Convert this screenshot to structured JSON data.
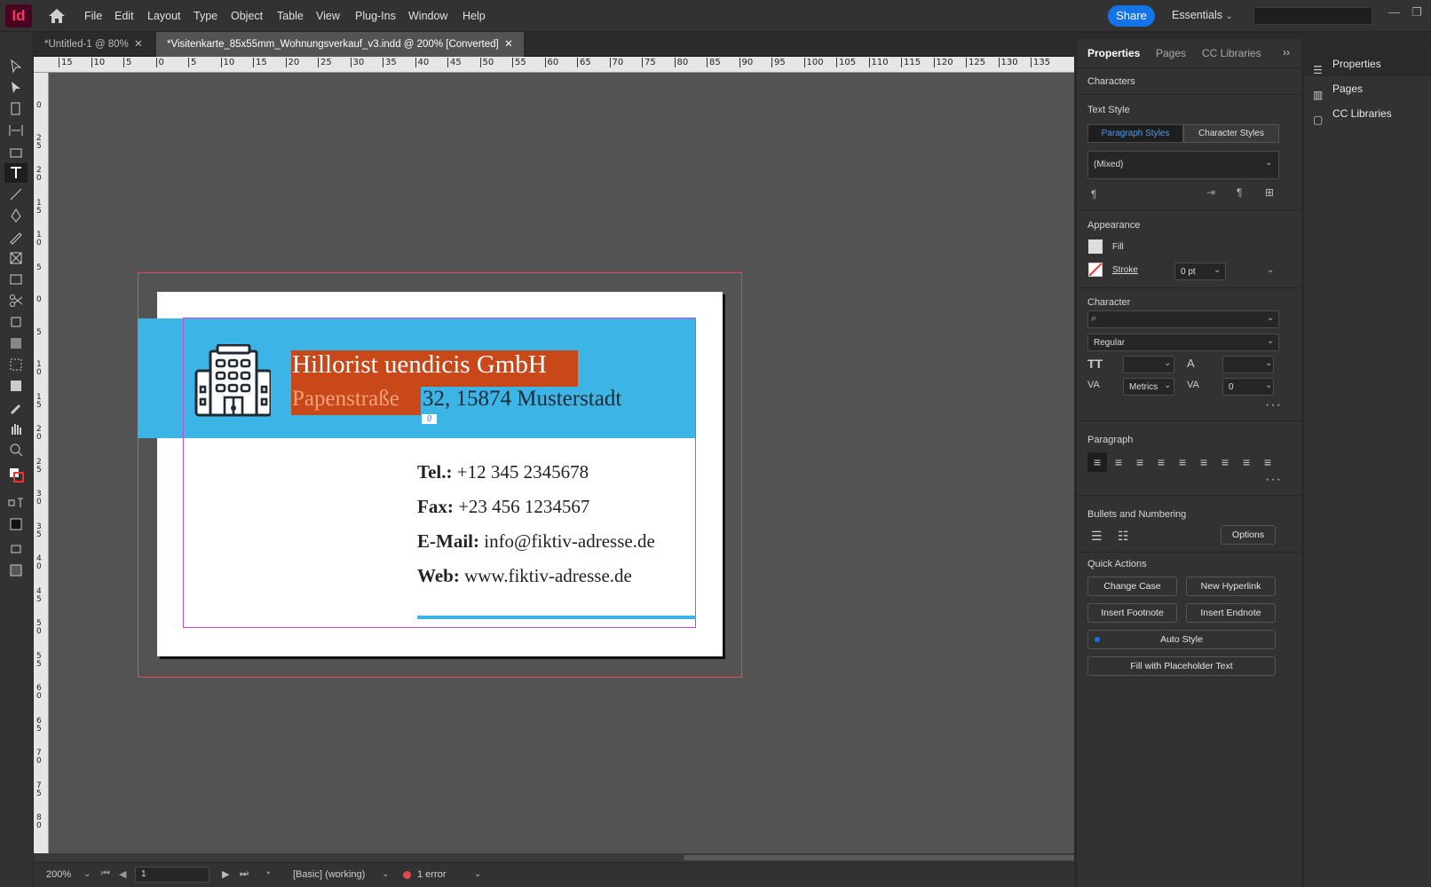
{
  "app": {
    "logo": "Id"
  },
  "menu": [
    "File",
    "Edit",
    "Layout",
    "Type",
    "Object",
    "Table",
    "View",
    "Plug-Ins",
    "Window",
    "Help"
  ],
  "header": {
    "share": "Share",
    "workspace": "Essentials"
  },
  "tabs": [
    {
      "label": "*Untitled-1 @ 80%"
    },
    {
      "label": "*Visitenkarte_85x55mm_Wohnungsverkauf_v3.indd @ 200% [Converted]"
    }
  ],
  "ruler": {
    "h_ticks": [
      "15",
      "10",
      "5",
      "0",
      "5",
      "10",
      "15",
      "20",
      "25",
      "30",
      "35",
      "40",
      "45",
      "50",
      "55",
      "60",
      "65",
      "70",
      "75",
      "80",
      "85",
      "90",
      "95",
      "100",
      "105",
      "110",
      "115",
      "120",
      "125",
      "130",
      "135"
    ],
    "v_ticks": [
      "0",
      "2\n5",
      "2\n0",
      "1\n5",
      "1\n0",
      "5",
      "0",
      "5",
      "1\n0",
      "1\n5",
      "2\n0",
      "2\n5",
      "3\n0",
      "3\n5",
      "4\n0",
      "4\n5",
      "5\n0",
      "5\n5",
      "6\n0",
      "6\n5",
      "7\n0",
      "7\n5",
      "8\n0"
    ]
  },
  "card": {
    "company": "Hillorist uendicis GmbH",
    "street": "Papenstraße ",
    "city": "32, 15874 Musterstadt",
    "overset": "0",
    "contacts": [
      {
        "label": "Tel.:",
        "value": " +12 345 2345678"
      },
      {
        "label": "Fax:",
        "value": " +23 456 1234567"
      },
      {
        "label": "E-Mail:",
        "value": " info@fiktiv-adresse.de"
      },
      {
        "label": "Web:",
        "value": " www.fiktiv-adresse.de"
      }
    ],
    "accent_color": "#3cb5e6",
    "selection_color": "#c9481a"
  },
  "status": {
    "zoom": "200%",
    "page": "1",
    "profile": "[Basic] (working)",
    "errors": "1 error"
  },
  "properties": {
    "tabs": [
      "Properties",
      "Pages",
      "CC Libraries"
    ],
    "context": "Characters",
    "text_style": {
      "title": "Text Style",
      "paragraph_styles": "Paragraph Styles",
      "character_styles": "Character Styles",
      "value": "(Mixed)"
    },
    "appearance": {
      "title": "Appearance",
      "fill": "Fill",
      "stroke": "Stroke",
      "stroke_value": "0 pt"
    },
    "character": {
      "title": "Character",
      "font_family": "",
      "font_style": "Regular",
      "kerning": "Metrics",
      "tracking": "0"
    },
    "paragraph": {
      "title": "Paragraph"
    },
    "bullets": {
      "title": "Bullets and Numbering",
      "options": "Options"
    },
    "quick_actions": {
      "title": "Quick Actions",
      "change_case": "Change Case",
      "new_hyperlink": "New Hyperlink",
      "insert_footnote": "Insert Footnote",
      "insert_endnote": "Insert Endnote",
      "auto_style": "Auto Style",
      "fill_placeholder": "Fill with Placeholder Text"
    }
  },
  "right_panel": [
    "Properties",
    "Pages",
    "CC Libraries"
  ]
}
